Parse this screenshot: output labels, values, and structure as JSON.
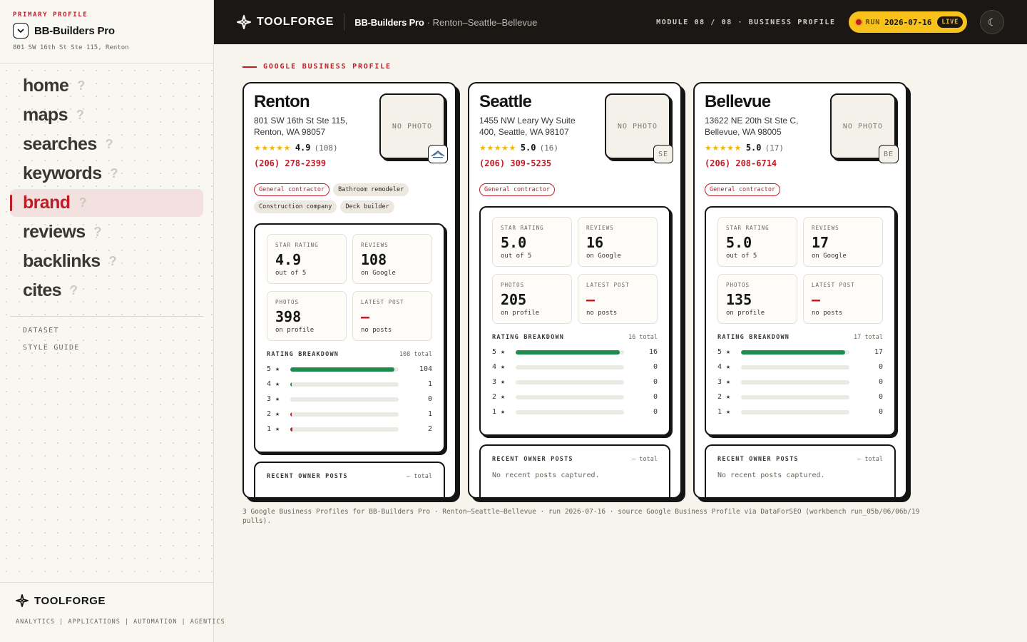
{
  "sidebar": {
    "eyebrow": "PRIMARY PROFILE",
    "profile_name": "BB-Builders Pro",
    "profile_address": "801 SW 16th St Ste 115, Renton",
    "nav": [
      {
        "label": "home",
        "q": "?"
      },
      {
        "label": "maps",
        "q": "?"
      },
      {
        "label": "searches",
        "q": "?"
      },
      {
        "label": "keywords",
        "q": "?"
      },
      {
        "label": "brand",
        "q": "?"
      },
      {
        "label": "reviews",
        "q": "?"
      },
      {
        "label": "backlinks",
        "q": "?"
      },
      {
        "label": "cites",
        "q": "?"
      }
    ],
    "active_item": "brand",
    "links": [
      "DATASET",
      "STYLE GUIDE"
    ],
    "footer_brand": "TOOLFORGE",
    "footer_tagline": "ANALYTICS | APPLICATIONS | AUTOMATION | AGENTICS"
  },
  "topbar": {
    "brand": "TOOLFORGE",
    "title": "BB-Builders Pro",
    "subtitle": "· Renton–Seattle–Bellevue",
    "module": "MODULE 08 / 08 · BUSINESS PROFILE",
    "run_label": "RUN",
    "run_date": "2026-07-16",
    "live": "LIVE",
    "theme_icon": "☾"
  },
  "main": {
    "section_title": "GOOGLE BUSINESS PROFILE",
    "photo_placeholder": "NO PHOTO",
    "labels": {
      "star_rating": "STAR RATING",
      "reviews": "REVIEWS",
      "photos": "PHOTOS",
      "latest_post": "LATEST POST",
      "out_of": "out of 5",
      "on_google": "on Google",
      "on_profile": "on profile",
      "no_posts": "no posts",
      "breakdown": "RATING BREAKDOWN",
      "recent_posts": "RECENT OWNER POSTS",
      "posts_total": "– total",
      "no_recent": "No recent posts captured."
    },
    "cards": [
      {
        "city": "Renton",
        "address": "801 SW 16th St Ste 115, Renton, WA 98057",
        "stars": "★★★★★",
        "rating": "4.9",
        "review_count": "(108)",
        "phone": "(206) 278-2399",
        "badge": "",
        "tags": [
          "General contractor",
          "Bathroom remodeler",
          "Construction company",
          "Deck builder"
        ],
        "star_rating": "4.9",
        "reviews": "108",
        "photos": "398",
        "latest_post": "—",
        "breakdown_total": "108 total",
        "breakdown": [
          {
            "star": "5 ★",
            "count": 104
          },
          {
            "star": "4 ★",
            "count": 1
          },
          {
            "star": "3 ★",
            "count": 0
          },
          {
            "star": "2 ★",
            "count": 1
          },
          {
            "star": "1 ★",
            "count": 2
          }
        ]
      },
      {
        "city": "Seattle",
        "address": "1455 NW Leary Wy Suite 400, Seattle, WA 98107",
        "stars": "★★★★★",
        "rating": "5.0",
        "review_count": "(16)",
        "phone": "(206) 309-5235",
        "badge": "SE",
        "tags": [
          "General contractor"
        ],
        "star_rating": "5.0",
        "reviews": "16",
        "photos": "205",
        "latest_post": "—",
        "breakdown_total": "16 total",
        "breakdown": [
          {
            "star": "5 ★",
            "count": 16
          },
          {
            "star": "4 ★",
            "count": 0
          },
          {
            "star": "3 ★",
            "count": 0
          },
          {
            "star": "2 ★",
            "count": 0
          },
          {
            "star": "1 ★",
            "count": 0
          }
        ]
      },
      {
        "city": "Bellevue",
        "address": "13622 NE 20th St Ste C, Bellevue, WA 98005",
        "stars": "★★★★★",
        "rating": "5.0",
        "review_count": "(17)",
        "phone": "(206) 208-6714",
        "badge": "BE",
        "tags": [
          "General contractor"
        ],
        "star_rating": "5.0",
        "reviews": "17",
        "photos": "135",
        "latest_post": "—",
        "breakdown_total": "17 total",
        "breakdown": [
          {
            "star": "5 ★",
            "count": 17
          },
          {
            "star": "4 ★",
            "count": 0
          },
          {
            "star": "3 ★",
            "count": 0
          },
          {
            "star": "2 ★",
            "count": 0
          },
          {
            "star": "1 ★",
            "count": 0
          }
        ]
      }
    ],
    "footnote": "3 Google Business Profiles for BB-Builders Pro · Renton–Seattle–Bellevue · run 2026-07-16 · source Google Business Profile via DataForSEO (workbench run_05b/06/06b/19 pulls)."
  },
  "colors": {
    "accent": "#c01c28",
    "bar_good": "#1e8a4c",
    "bar_bad": "#c01c28",
    "star": "#f2b705",
    "live_pill": "#f7c21b",
    "dark": "#1a1714"
  }
}
